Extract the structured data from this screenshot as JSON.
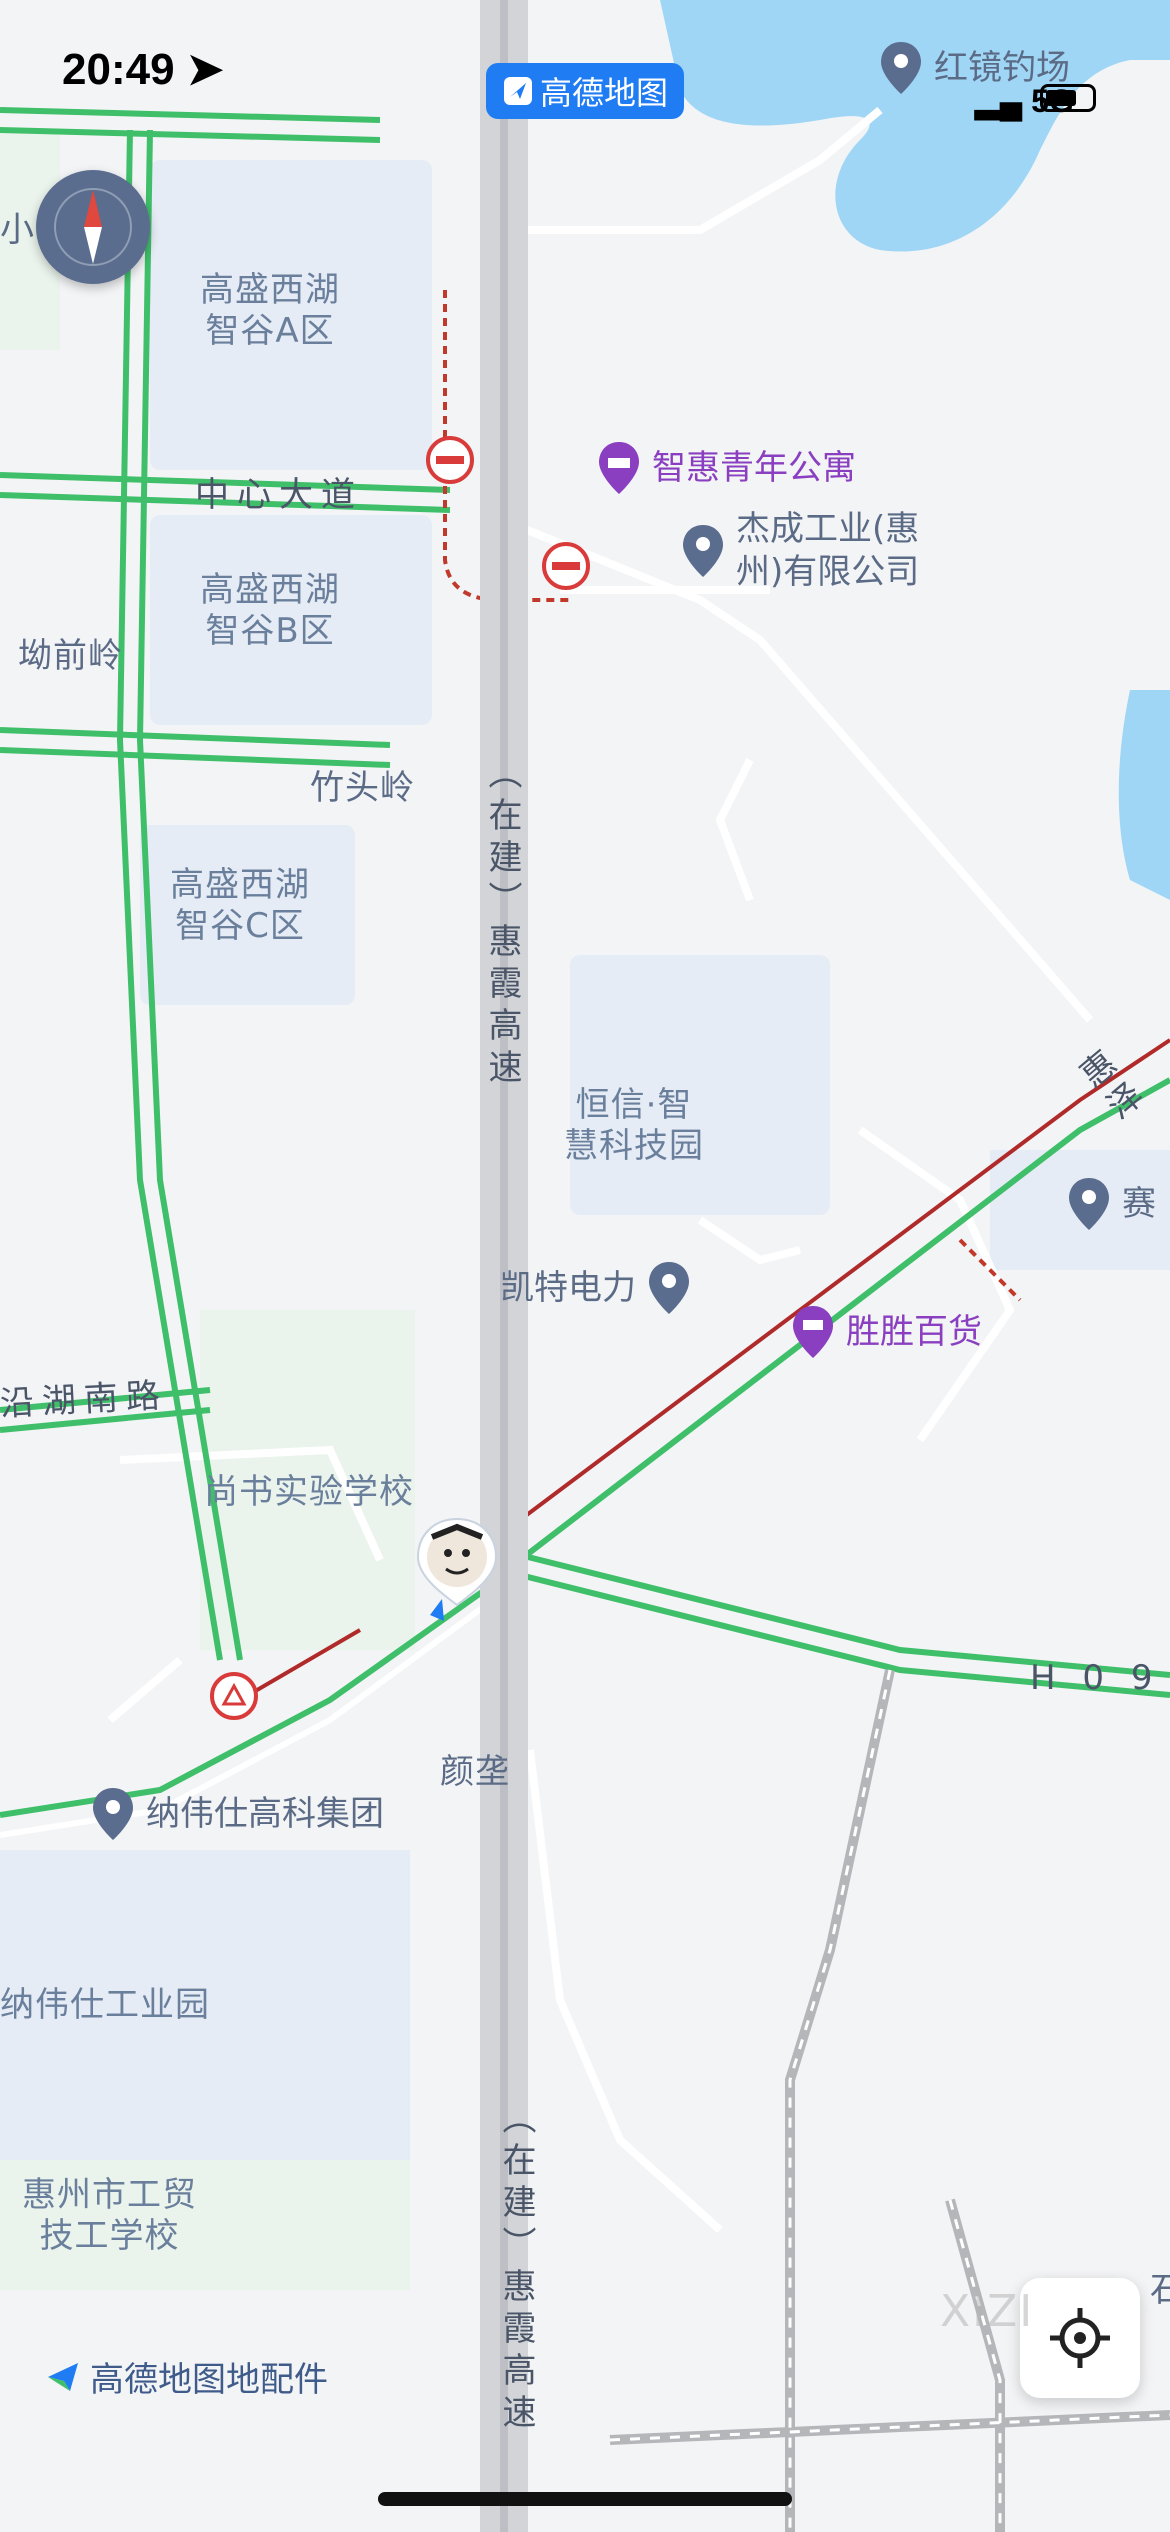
{
  "status_bar": {
    "time": "20:49",
    "app_badge": "高德地图",
    "network": "5G"
  },
  "map": {
    "areas": [
      {
        "id": "a",
        "text": "高盛西湖\n智谷A区"
      },
      {
        "id": "b",
        "text": "高盛西湖\n智谷B区"
      },
      {
        "id": "c",
        "text": "高盛西湖\n智谷C区"
      },
      {
        "id": "hengxin",
        "text": "恒信·智\n慧科技园"
      },
      {
        "id": "naweishi_park",
        "text": "纳伟仕工业园"
      },
      {
        "id": "school_tech",
        "text": "惠州市工贸\n技工学校"
      },
      {
        "id": "shangshu",
        "text": "尚书实验学校"
      }
    ],
    "places": [
      {
        "id": "aoqianling",
        "text": "坳前岭"
      },
      {
        "id": "zhutouling",
        "text": "竹头岭"
      },
      {
        "id": "yanken",
        "text": "颜垄"
      },
      {
        "id": "top_left",
        "text": "小学"
      },
      {
        "id": "right_edge",
        "text": "石"
      }
    ],
    "roads": [
      {
        "id": "zhongxin",
        "text": "中心大道"
      },
      {
        "id": "yanhu",
        "text": "沿湖南路"
      },
      {
        "id": "h0",
        "text": "H 0 9"
      },
      {
        "id": "huize",
        "text": "惠泽"
      },
      {
        "id": "highway_top",
        "text": "（在建）惠霞高速"
      },
      {
        "id": "highway_bottom",
        "text": "（在建）惠霞高速"
      }
    ],
    "pois": [
      {
        "id": "zhihui",
        "text": "智惠青年公寓",
        "color": "purple",
        "icon": "hotel-icon"
      },
      {
        "id": "jiecheng",
        "text": "杰成工业(惠\n州)有限公司",
        "color": "blue",
        "icon": "location-pin-icon"
      },
      {
        "id": "kaite",
        "text": "凯特电力",
        "color": "blue",
        "icon": "location-pin-icon"
      },
      {
        "id": "shengsheng",
        "text": "胜胜百货",
        "color": "purple",
        "icon": "shopping-cart-icon"
      },
      {
        "id": "naweishi",
        "text": "纳伟仕高科集团",
        "color": "blue",
        "icon": "location-pin-icon"
      },
      {
        "id": "sai",
        "text": "赛",
        "color": "blue",
        "icon": "location-pin-icon"
      },
      {
        "id": "hongjin",
        "text": "红镜钓场",
        "color": "blue",
        "icon": "location-pin-icon"
      }
    ]
  },
  "attribution": "高德地图地配件",
  "watermark": "XIZI",
  "colors": {
    "brand": "#1f7cf2",
    "road_green": "#3fbf6a",
    "road_red": "#b02a2a",
    "water": "#9fd6f5",
    "poi_purple": "#8a3fc0",
    "pin_blue": "#5b6d8e"
  }
}
